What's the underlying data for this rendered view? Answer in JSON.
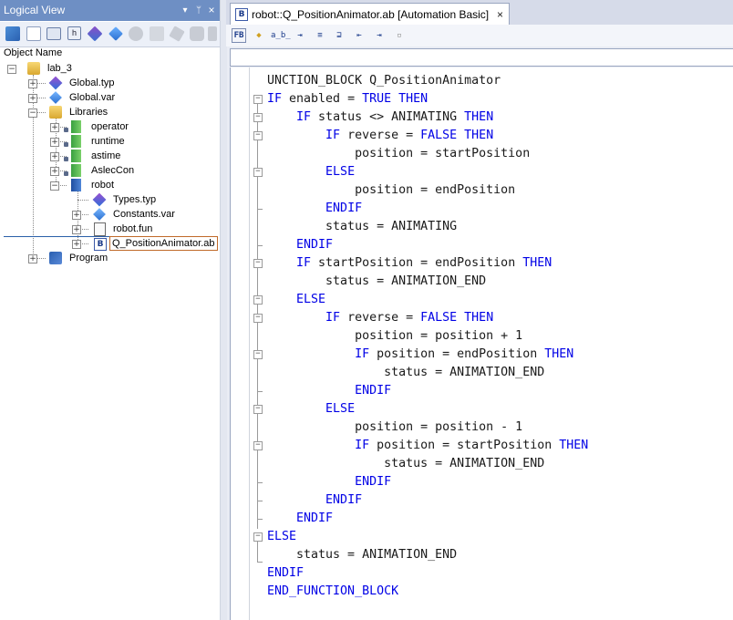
{
  "left_pane": {
    "title": "Logical View",
    "title_buttons": [
      "▾",
      "ᛘ",
      "×"
    ],
    "toolbar_icons": [
      "package-icon",
      "table-icon",
      "monitor-icon",
      "h-icon",
      "type-icon",
      "var-icon",
      "gear-icon",
      "doc-icon",
      "wrench-icon",
      "config-icon",
      "arrow-icon"
    ],
    "column_header": "Object Name",
    "tree": [
      {
        "label": "lab_3",
        "icon": "folder-icon"
      },
      {
        "label": "Global.typ",
        "icon": "type-file-icon"
      },
      {
        "label": "Global.var",
        "icon": "var-file-icon"
      },
      {
        "label": "Libraries",
        "icon": "folder-icon"
      },
      {
        "label": "operator",
        "icon": "library-icon"
      },
      {
        "label": "runtime",
        "icon": "library-icon"
      },
      {
        "label": "astime",
        "icon": "library-icon"
      },
      {
        "label": "AslecCon",
        "icon": "library-icon"
      },
      {
        "label": "robot",
        "icon": "library-icon"
      },
      {
        "label": "Types.typ",
        "icon": "type-file-icon"
      },
      {
        "label": "Constants.var",
        "icon": "var-file-icon"
      },
      {
        "label": "robot.fun",
        "icon": "function-file-icon"
      },
      {
        "label": "Q_PositionAnimator.ab",
        "icon": "ab-file-icon"
      },
      {
        "label": "Program",
        "icon": "program-icon"
      }
    ]
  },
  "editor": {
    "tab_title": "robot::Q_PositionAnimator.ab [Automation Basic]",
    "tab_icon_letter": "B",
    "tab_close": "×",
    "toolbar": [
      "FB",
      "◆",
      "a̲b̲",
      "⇥",
      "≡",
      "⊒",
      "⇤",
      "⇥",
      "▫"
    ],
    "code_lines": [
      [
        [
          "t",
          "UNCTION_BLOCK Q_PositionAnimator"
        ]
      ],
      [
        [
          "k",
          "IF"
        ],
        [
          "t",
          " enabled = "
        ],
        [
          "k",
          "TRUE"
        ],
        [
          "t",
          " "
        ],
        [
          "k",
          "THEN"
        ]
      ],
      [
        [
          "t",
          "    "
        ],
        [
          "k",
          "IF"
        ],
        [
          "t",
          " status <> ANIMATING "
        ],
        [
          "k",
          "THEN"
        ]
      ],
      [
        [
          "t",
          "        "
        ],
        [
          "k",
          "IF"
        ],
        [
          "t",
          " reverse = "
        ],
        [
          "k",
          "FALSE"
        ],
        [
          "t",
          " "
        ],
        [
          "k",
          "THEN"
        ]
      ],
      [
        [
          "t",
          "            position = startPosition"
        ]
      ],
      [
        [
          "t",
          "        "
        ],
        [
          "k",
          "ELSE"
        ]
      ],
      [
        [
          "t",
          "            position = endPosition"
        ]
      ],
      [
        [
          "t",
          "        "
        ],
        [
          "k",
          "ENDIF"
        ]
      ],
      [
        [
          "t",
          "        status = ANIMATING"
        ]
      ],
      [
        [
          "t",
          "    "
        ],
        [
          "k",
          "ENDIF"
        ]
      ],
      [
        [
          "t",
          "    "
        ],
        [
          "k",
          "IF"
        ],
        [
          "t",
          " startPosition = endPosition "
        ],
        [
          "k",
          "THEN"
        ]
      ],
      [
        [
          "t",
          "        status = ANIMATION_END"
        ]
      ],
      [
        [
          "t",
          "    "
        ],
        [
          "k",
          "ELSE"
        ]
      ],
      [
        [
          "t",
          "        "
        ],
        [
          "k",
          "IF"
        ],
        [
          "t",
          " reverse = "
        ],
        [
          "k",
          "FALSE"
        ],
        [
          "t",
          " "
        ],
        [
          "k",
          "THEN"
        ]
      ],
      [
        [
          "t",
          "            position = position + 1"
        ]
      ],
      [
        [
          "t",
          "            "
        ],
        [
          "k",
          "IF"
        ],
        [
          "t",
          " position = endPosition "
        ],
        [
          "k",
          "THEN"
        ]
      ],
      [
        [
          "t",
          "                status = ANIMATION_END"
        ]
      ],
      [
        [
          "t",
          "            "
        ],
        [
          "k",
          "ENDIF"
        ]
      ],
      [
        [
          "t",
          "        "
        ],
        [
          "k",
          "ELSE"
        ]
      ],
      [
        [
          "t",
          "            position = position - 1"
        ]
      ],
      [
        [
          "t",
          "            "
        ],
        [
          "k",
          "IF"
        ],
        [
          "t",
          " position = startPosition "
        ],
        [
          "k",
          "THEN"
        ]
      ],
      [
        [
          "t",
          "                status = ANIMATION_END"
        ]
      ],
      [
        [
          "t",
          "            "
        ],
        [
          "k",
          "ENDIF"
        ]
      ],
      [
        [
          "t",
          "        "
        ],
        [
          "k",
          "ENDIF"
        ]
      ],
      [
        [
          "t",
          "    "
        ],
        [
          "k",
          "ENDIF"
        ]
      ],
      [
        [
          "k",
          "ELSE"
        ]
      ],
      [
        [
          "t",
          "    status = ANIMATION_END"
        ]
      ],
      [
        [
          "k",
          "ENDIF"
        ]
      ],
      [
        [
          "k",
          "END_FUNCTION_BLOCK"
        ]
      ]
    ]
  },
  "colors": {
    "keyword": "#0000e6",
    "text": "#1a1a1a",
    "title_bar": "#6e8fc4"
  }
}
